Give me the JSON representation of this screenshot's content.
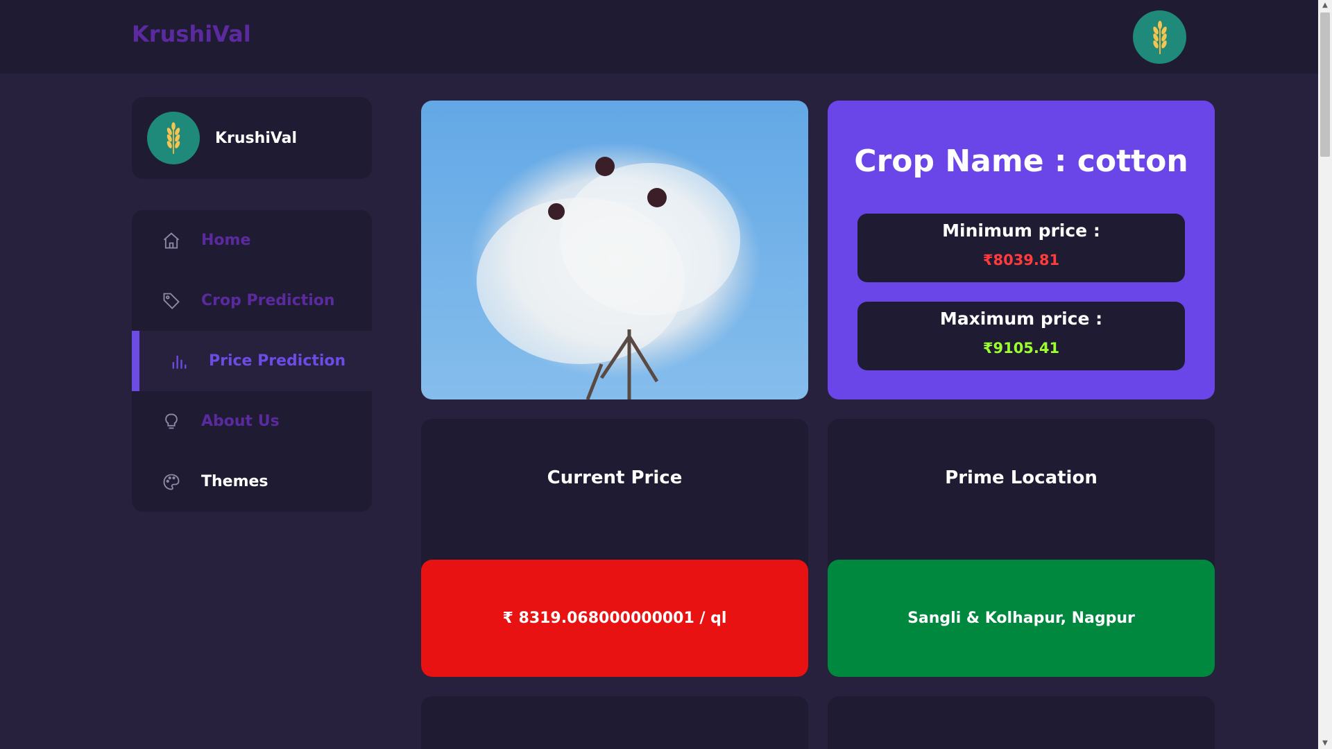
{
  "app": {
    "brand": "KrushiVal"
  },
  "profile": {
    "name": "KrushiVal"
  },
  "nav": {
    "items": [
      {
        "label": "Home",
        "icon": "home-icon"
      },
      {
        "label": "Crop Prediction",
        "icon": "tag-icon"
      },
      {
        "label": "Price Prediction",
        "icon": "bar-chart-icon",
        "active": true
      },
      {
        "label": "About Us",
        "icon": "lightbulb-icon"
      },
      {
        "label": "Themes",
        "icon": "palette-icon"
      }
    ]
  },
  "crop": {
    "title": "Crop Name : cotton",
    "min_label": "Minimum price :",
    "min_value": "₹8039.81",
    "max_label": "Maximum price :",
    "max_value": "₹9105.41"
  },
  "current": {
    "title": "Current Price",
    "value": "₹ 8319.068000000001 / ql"
  },
  "location": {
    "title": "Prime Location",
    "value": "Sangli & Kolhapur, Nagpur"
  },
  "colors": {
    "background": "#27213d",
    "panel": "#1f1b33",
    "accent": "#6a45e8",
    "brand": "#5b2a9e",
    "min_price": "#ff3b3b",
    "max_price": "#9cff2e",
    "current_band": "#e81212",
    "location_band": "#00883f",
    "avatar": "#1f8a79"
  }
}
